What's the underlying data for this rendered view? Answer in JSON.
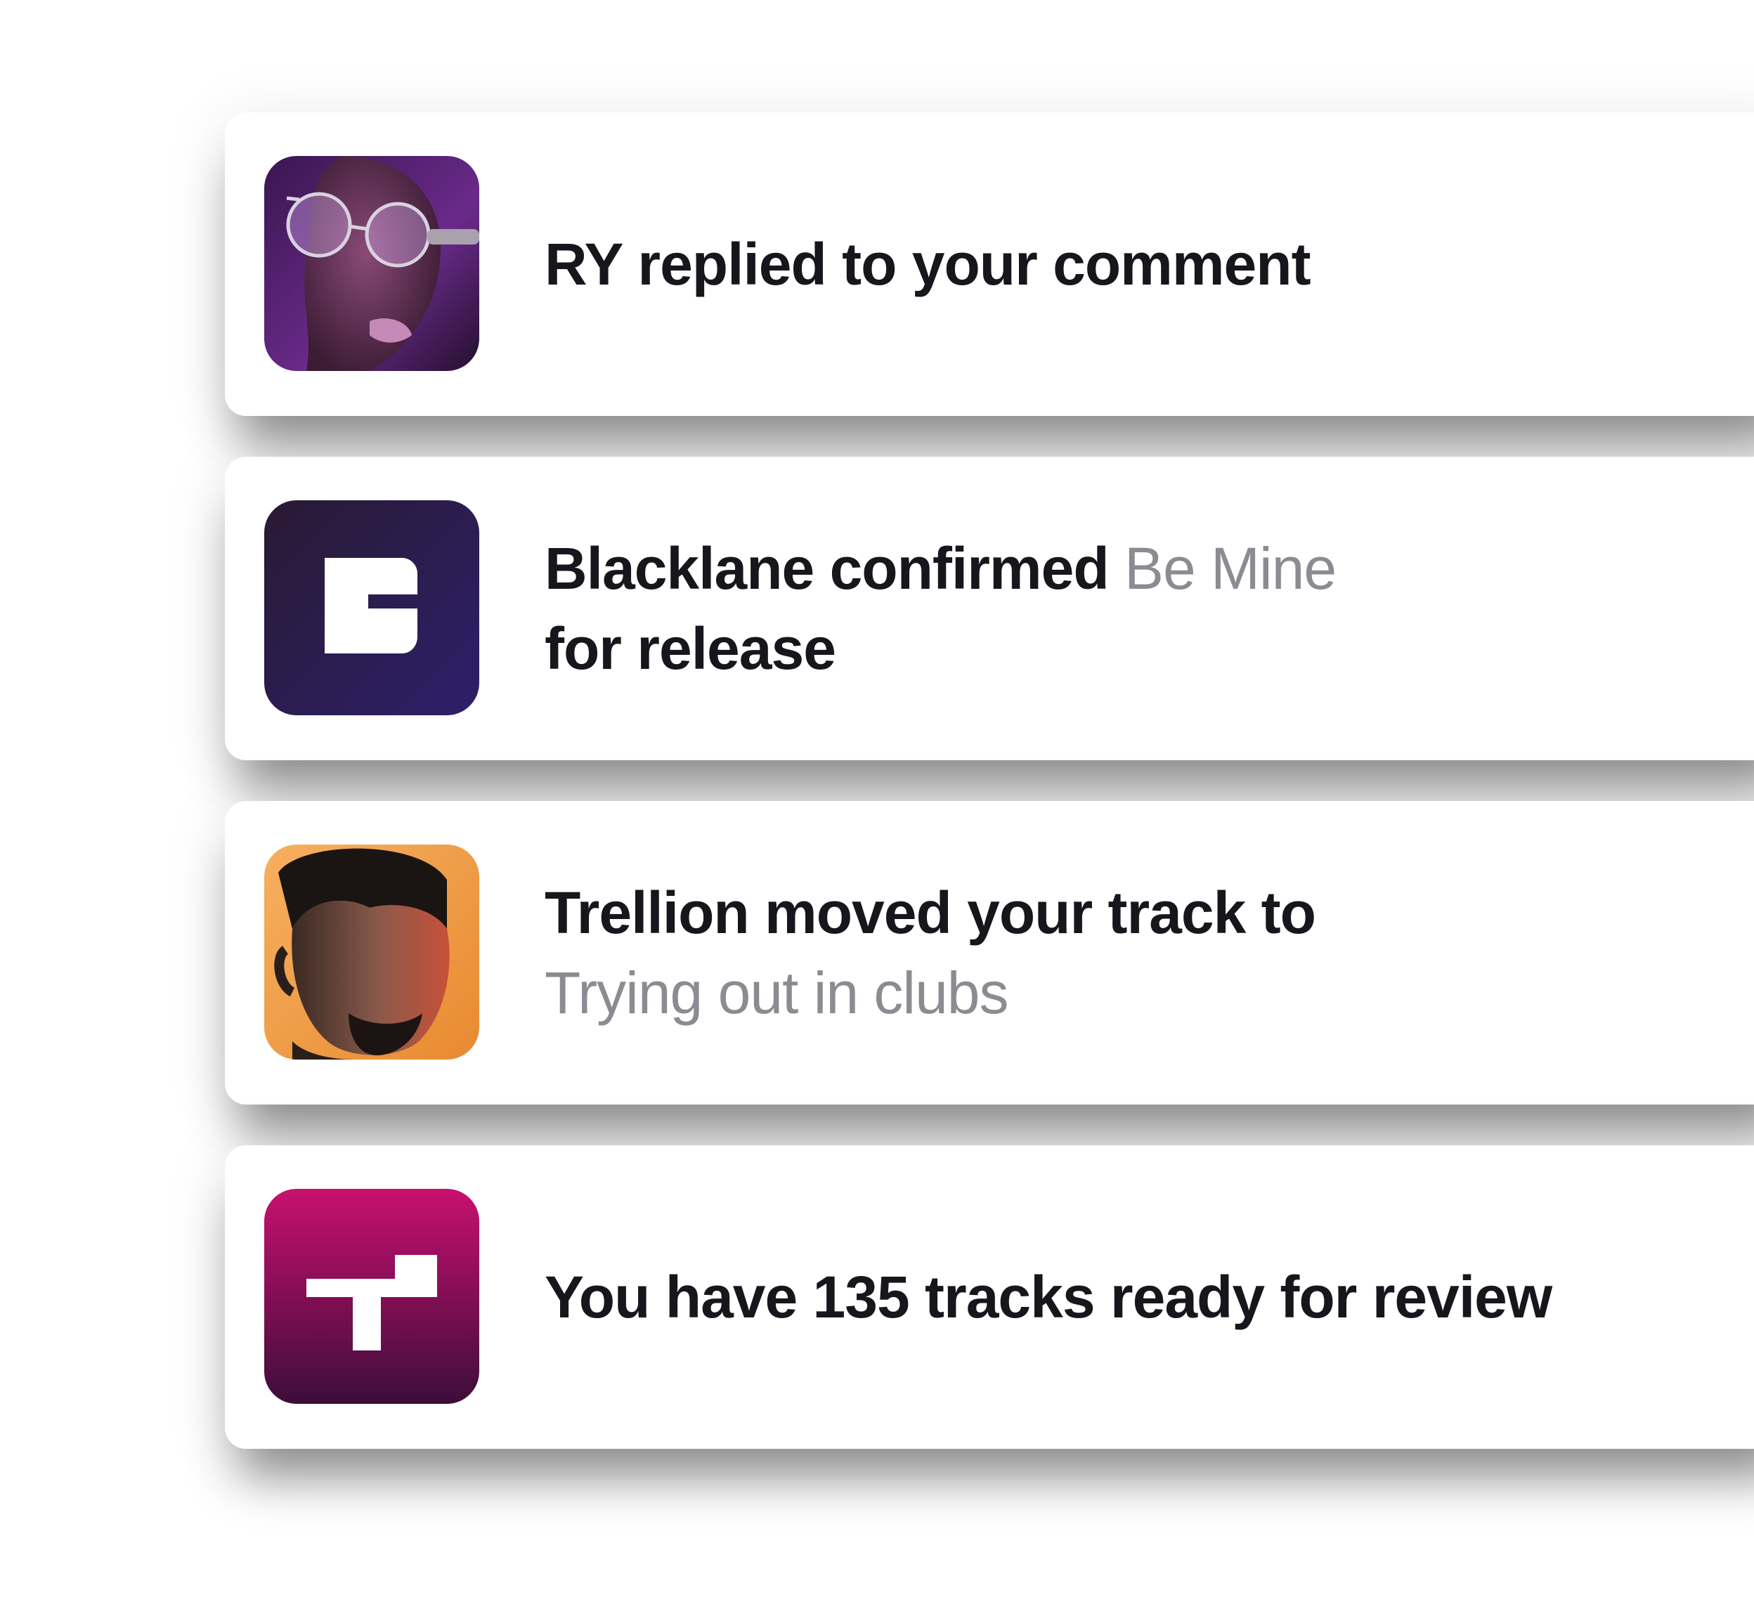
{
  "notifications": [
    {
      "avatar_icon": "portrait-woman-glasses-avatar",
      "text_strong_1": "RY replied to your comment",
      "text_muted": "",
      "text_strong_2": ""
    },
    {
      "avatar_icon": "blacklane-b-logo-icon",
      "text_strong_1": "Blacklane confirmed ",
      "text_muted": "Be Mine",
      "text_strong_2": "for release"
    },
    {
      "avatar_icon": "portrait-man-avatar",
      "text_strong_1": "Trellion moved your track to",
      "text_muted": "Trying out in clubs",
      "text_strong_2": ""
    },
    {
      "avatar_icon": "trellion-t-logo-icon",
      "text_strong_1": "You have 135 tracks ready for review",
      "text_muted": "",
      "text_strong_2": ""
    }
  ],
  "colors": {
    "text_strong": "#16161c",
    "text_muted": "#8b8b91",
    "blacklane_gradient_start": "#2a1a33",
    "blacklane_gradient_end": "#2d1f6a",
    "trellion_gradient_start": "#c8106f",
    "trellion_gradient_end": "#3d0d3a",
    "portrait_man_background": "#f0a040"
  }
}
